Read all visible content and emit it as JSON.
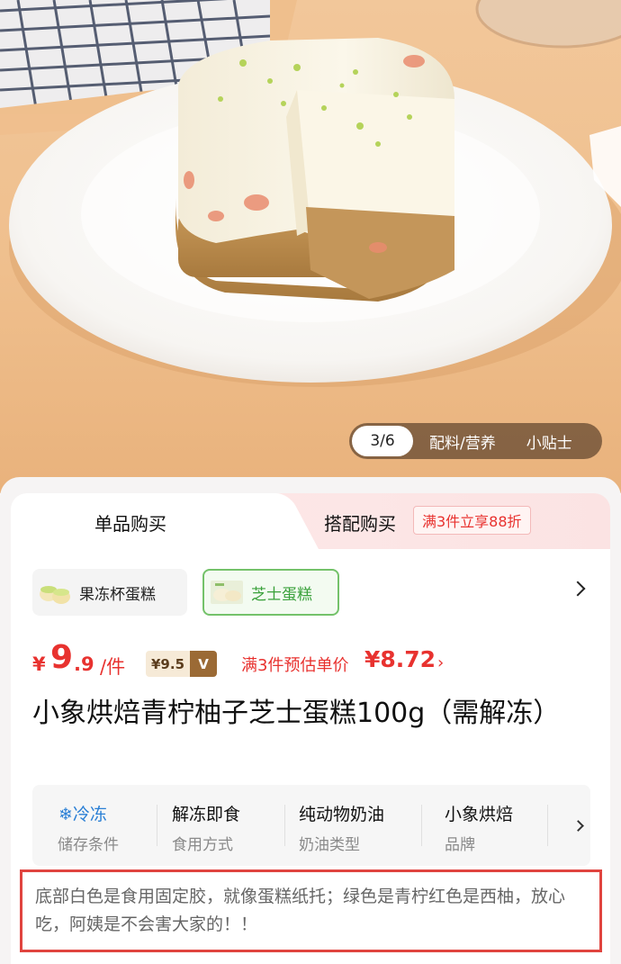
{
  "product_image": {
    "counter": "3/6",
    "ingredients_link": "配料/营养",
    "tips_link": "小贴士"
  },
  "tabs": {
    "single": "单品购买",
    "combo": "搭配购买",
    "promo": "满3件立享88折"
  },
  "variants": [
    {
      "label": "果冻杯蛋糕",
      "selected": false
    },
    {
      "label": "芝士蛋糕",
      "selected": true
    }
  ],
  "price": {
    "currency": "¥",
    "integer": "9",
    "decimal": ".9",
    "unit": "/件",
    "member_price": "¥9.5",
    "member_badge": "V",
    "estimate_label": "满3件预估单价",
    "estimate_price": "¥8.72",
    "estimate_chevron": "›"
  },
  "product_title": "小象烘焙青柠柚子芝士蛋糕100g（需解冻）",
  "attributes": [
    {
      "value": "冷冻",
      "key": "储存条件",
      "icon": "snowflake-icon"
    },
    {
      "value": "解冻即食",
      "key": "食用方式"
    },
    {
      "value": "纯动物奶油",
      "key": "奶油类型"
    },
    {
      "value": "小象烘焙",
      "key": "品牌"
    }
  ],
  "annotation": "底部白色是食用固定胶，就像蛋糕纸托；绿色是青柠红色是西柚，放心吃，阿姨是不会害大家的！！",
  "colors": {
    "accent_red": "#e8322f",
    "selected_green": "#3aa13b",
    "annotation_border": "#e0443f"
  }
}
